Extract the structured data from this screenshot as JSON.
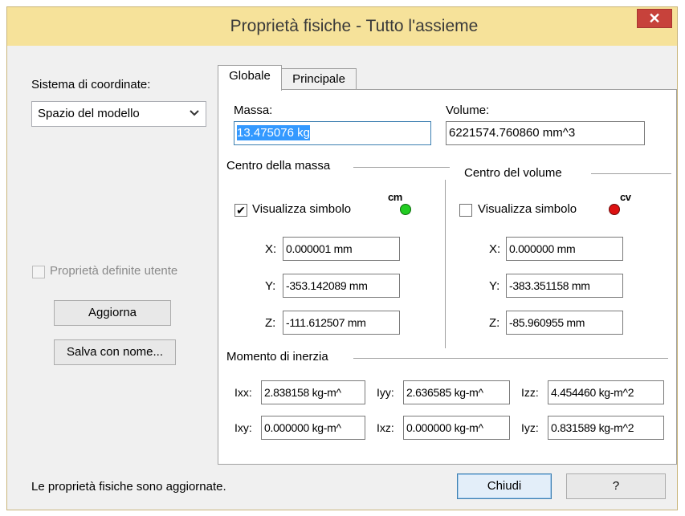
{
  "window": {
    "title": "Proprietà fisiche - Tutto l'assieme",
    "close_glyph": "✕"
  },
  "left": {
    "coord_label": "Sistema di coordinate:",
    "coord_value": "Spazio del modello",
    "user_props_label": "Proprietà definite utente",
    "user_props_checked": false,
    "update_button": "Aggiorna",
    "save_as_button": "Salva con nome..."
  },
  "tabs": [
    {
      "label": "Globale",
      "active": true
    },
    {
      "label": "Principale",
      "active": false
    }
  ],
  "global": {
    "mass_label": "Massa:",
    "mass_value": "13.475076 kg",
    "volume_label": "Volume:",
    "volume_value": "6221574.760860 mm^3",
    "center_mass": {
      "title": "Centro della massa",
      "show_symbol_label": "Visualizza simbolo",
      "show_symbol_checked": true,
      "symbol_text": "cm",
      "symbol_color": "#22cc22",
      "x_label": "X:",
      "x_value": "0.000001 mm",
      "y_label": "Y:",
      "y_value": "-353.142089 mm",
      "z_label": "Z:",
      "z_value": "-111.612507 mm"
    },
    "center_volume": {
      "title": "Centro del volume",
      "show_symbol_label": "Visualizza simbolo",
      "show_symbol_checked": false,
      "symbol_text": "cv",
      "symbol_color": "#dd1111",
      "x_label": "X:",
      "x_value": "0.000000 mm",
      "y_label": "Y:",
      "y_value": "-383.351158 mm",
      "z_label": "Z:",
      "z_value": "-85.960955 mm"
    },
    "inertia": {
      "title": "Momento di inerzia",
      "ixx_label": "Ixx:",
      "ixx_value": "2.838158 kg-m^",
      "iyy_label": "Iyy:",
      "iyy_value": "2.636585 kg-m^",
      "izz_label": "Izz:",
      "izz_value": "4.454460 kg-m^2",
      "ixy_label": "Ixy:",
      "ixy_value": "0.000000 kg-m^",
      "ixz_label": "Ixz:",
      "ixz_value": "0.000000 kg-m^",
      "iyz_label": "Iyz:",
      "iyz_value": "0.831589 kg-m^2"
    }
  },
  "footer": {
    "status": "Le proprietà fisiche sono aggiornate.",
    "close_button": "Chiudi",
    "help_button": "?"
  }
}
